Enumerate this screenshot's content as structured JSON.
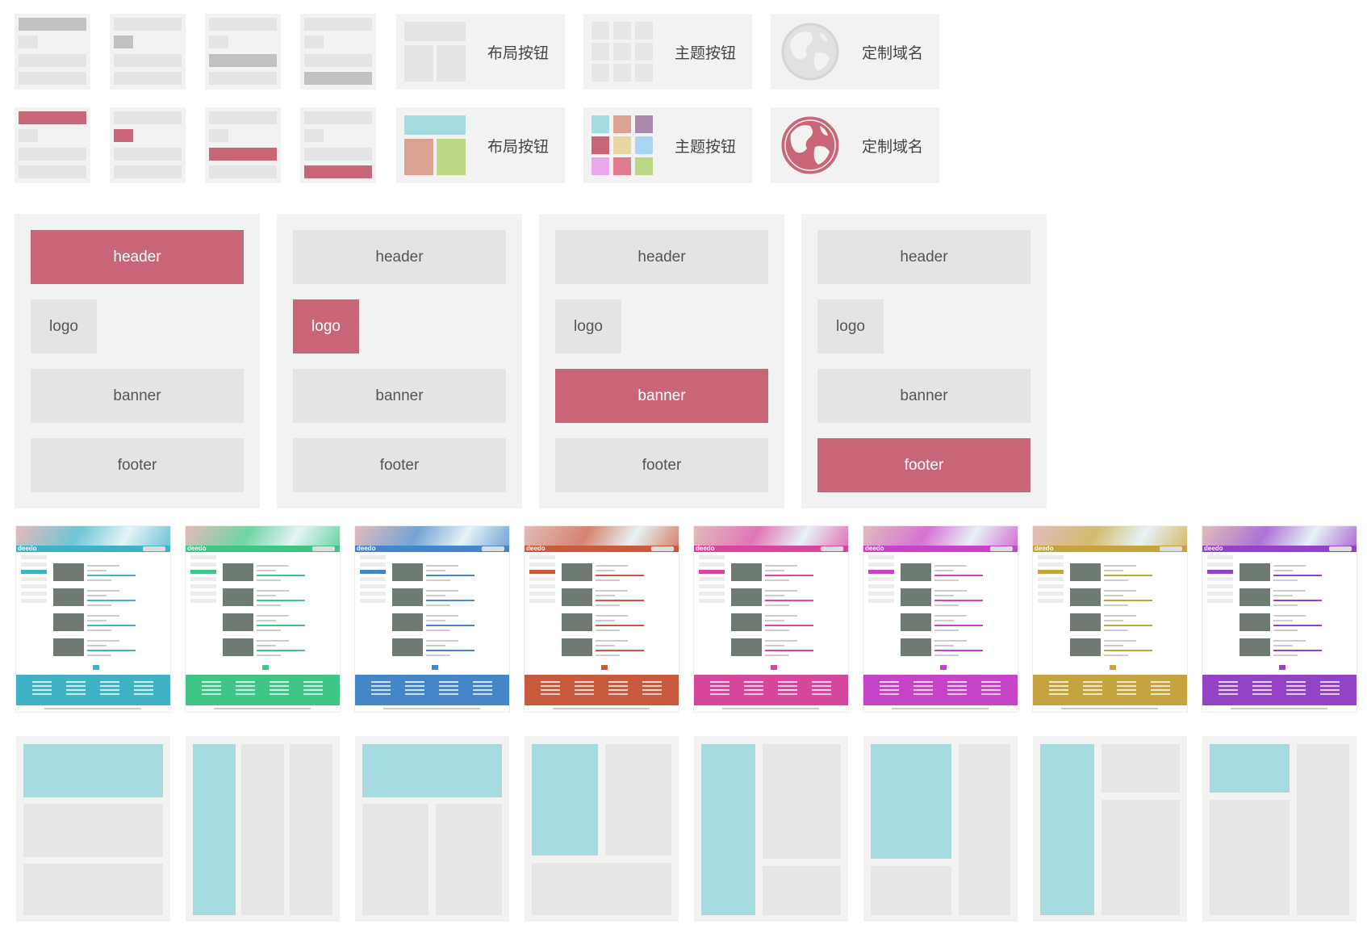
{
  "colors": {
    "accent": "#c86677",
    "tile_bg": "#f3f2f2",
    "block_grey": "#e4e4e4",
    "highlight_cyan": "#a6dbe0"
  },
  "buttons": {
    "layout_label": "布局按钮",
    "theme_label": "主题按钮",
    "domain_label": "定制域名"
  },
  "blocks": {
    "header": "header",
    "logo": "logo",
    "banner": "banner",
    "footer": "footer"
  },
  "theme_palette": [
    "#a6dbe0",
    "#dba291",
    "#a98aad",
    "#c86677",
    "#e8d7a1",
    "#a9d6f2",
    "#eaa7eb",
    "#e27a8e",
    "#bdd884"
  ],
  "theme_previews": {
    "brand_logo_text": "deedo",
    "themes": [
      {
        "name": "cyan",
        "color": "#3fb2c6"
      },
      {
        "name": "green",
        "color": "#3fc687"
      },
      {
        "name": "blue",
        "color": "#4486c8"
      },
      {
        "name": "orange-red",
        "color": "#c85a3e"
      },
      {
        "name": "pink",
        "color": "#d6479c"
      },
      {
        "name": "magenta",
        "color": "#c743c7"
      },
      {
        "name": "gold",
        "color": "#c5a43f"
      },
      {
        "name": "purple",
        "color": "#9243c6"
      }
    ]
  }
}
